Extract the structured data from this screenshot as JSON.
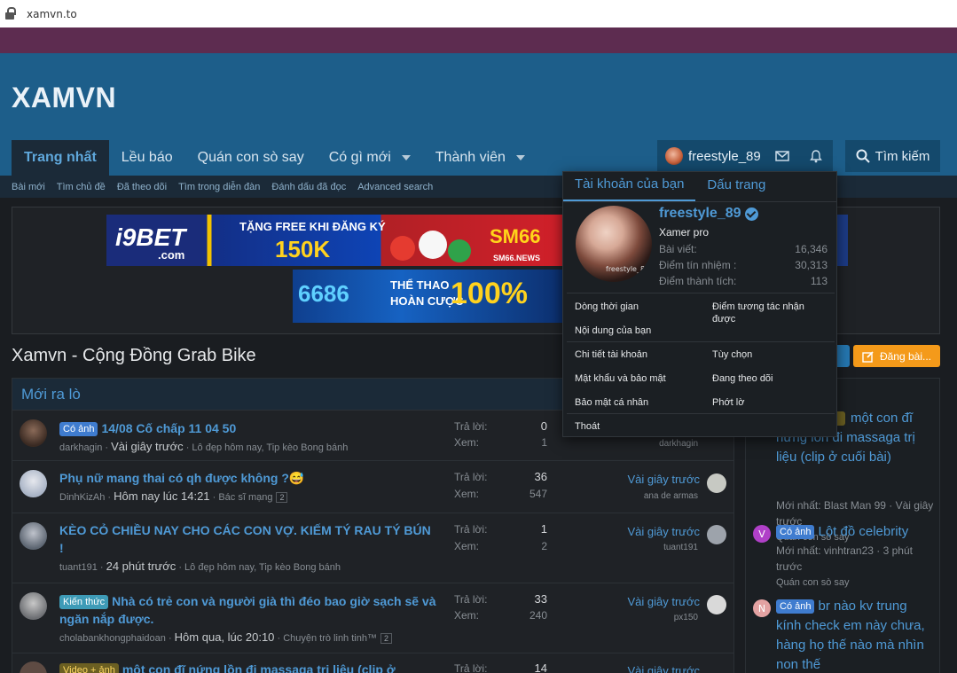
{
  "browser": {
    "url": "xamvn.to"
  },
  "site": {
    "logo": "XAMVN"
  },
  "nav": {
    "tabs": [
      {
        "label": "Trang nhất"
      },
      {
        "label": "Lều báo"
      },
      {
        "label": "Quán con sò say"
      },
      {
        "label": "Có gì mới"
      },
      {
        "label": "Thành viên"
      }
    ],
    "user": "freestyle_89",
    "search": "Tìm kiếm"
  },
  "subnav": [
    "Bài mới",
    "Tìm chủ đề",
    "Đã theo dõi",
    "Tìm trong diễn đàn",
    "Đánh dấu đã đọc",
    "Advanced search"
  ],
  "banners": {
    "b1_brand": "i9BET",
    "b1_sub": ".com",
    "b1_promo": "TẶNG FREE KHI ĐĂNG KÝ",
    "b1_amount": "150K",
    "b1_brand2": "SM66",
    "b1_brand2_sub": "SM66.NEWS",
    "b2_brand": "6686",
    "b2_promo_1": "THỂ THAO",
    "b2_promo_2": "HOÀN CƯỢC",
    "b2_amount": "100%"
  },
  "page": {
    "title": "Xamvn - Cộng Đồng Grab Bike",
    "post_button": "Đăng bài..."
  },
  "main": {
    "heading": "Mới ra lò",
    "label_replies": "Trả lời:",
    "label_views": "Xem:",
    "threads": [
      {
        "badge": "Có ảnh",
        "title": "14/08 Cố chấp 11 04 50",
        "author": "darkhagin",
        "time": "Vài giây trước",
        "forum": "Lô đẹp hôm nay, Tip kèo Bong bánh",
        "replies": "0",
        "views": "1",
        "last_time": "",
        "last_user": "darkhagin"
      },
      {
        "badge": "",
        "title": "Phụ nữ mang thai có qh được không ?😅",
        "author": "DinhKizAh",
        "time": "Hôm nay lúc 14:21",
        "forum": "Bác sĩ mạng",
        "pages": "2",
        "replies": "36",
        "views": "547",
        "last_time": "Vài giây trước",
        "last_user": "ana de armas"
      },
      {
        "badge": "",
        "title": "KÈO CỎ CHIỀU NAY CHO CÁC CON VỢ. KIẾM TÝ RAU TÝ BÚN !",
        "author": "tuant191",
        "time": "24 phút trước",
        "forum": "Lô đẹp hôm nay, Tip kèo Bong bánh",
        "replies": "1",
        "views": "2",
        "last_time": "Vài giây trước",
        "last_user": "tuant191"
      },
      {
        "badge": "Kiến thức",
        "title": "Nhà có trẻ con và người già thì đéo bao giờ sạch sẽ và ngăn nắp được.",
        "author": "cholabankhongphaidoan",
        "time": "Hôm qua, lúc 20:10",
        "forum": "Chuyện trò linh tinh™",
        "pages": "2",
        "replies": "33",
        "views": "240",
        "last_time": "Vài giây trước",
        "last_user": "px150"
      },
      {
        "badge": "Video + ảnh",
        "title": "một con đĩ nứng lồn đi massaga trị liệu (clip ở",
        "replies": "14",
        "last_time": "Vài giây trước"
      }
    ]
  },
  "sidebar": {
    "items": [
      {
        "avatar": "",
        "badge": "",
        "title_line": "một con đĩ nứng lồn đi massaga trị liệu (clip ở cuối bài)",
        "meta": "Mới nhất: Blast Man 99 · Vài giây trước",
        "forum": "Quán con sò say"
      },
      {
        "avatar": "V",
        "badge": "Có ảnh",
        "title_line": "Lột đồ celebrity",
        "meta": "Mới nhất: vinhtran23 · 3 phút trước",
        "forum": "Quán con sò say"
      },
      {
        "avatar": "N",
        "badge": "Có ảnh",
        "title_line": "br nào kv trung kính check em này chưa, hàng họ thế nào mà nhìn non thế",
        "meta": "",
        "forum": ""
      }
    ]
  },
  "dropdown": {
    "tab_account": "Tài khoản của bạn",
    "tab_bookmarks": "Dấu trang",
    "username": "freestyle_89",
    "user_title": "Xamer pro",
    "avatar_watermark": "freestyle_89",
    "stats": [
      {
        "label": "Bài viết:",
        "value": "16,346"
      },
      {
        "label": "Điểm tín nhiệm :",
        "value": "30,313"
      },
      {
        "label": "Điểm thành tích:",
        "value": "113"
      }
    ],
    "links": {
      "timeline": "Dòng thời gian",
      "reactions": "Điểm tương tác nhận được",
      "your_content": "Nội dung của bạn",
      "account_details": "Chi tiết tài khoản",
      "preferences": "Tùy chọn",
      "password_security": "Mật khẩu và bảo mật",
      "following": "Đang theo dõi",
      "privacy": "Bảo mật cá nhân",
      "ignoring": "Phớt lờ",
      "logout": "Thoát"
    }
  },
  "colors": {
    "header": "#1d5e8a",
    "plum": "#5d2c50",
    "accent": "#4f9ad6",
    "post_button": "#f49a1a"
  }
}
